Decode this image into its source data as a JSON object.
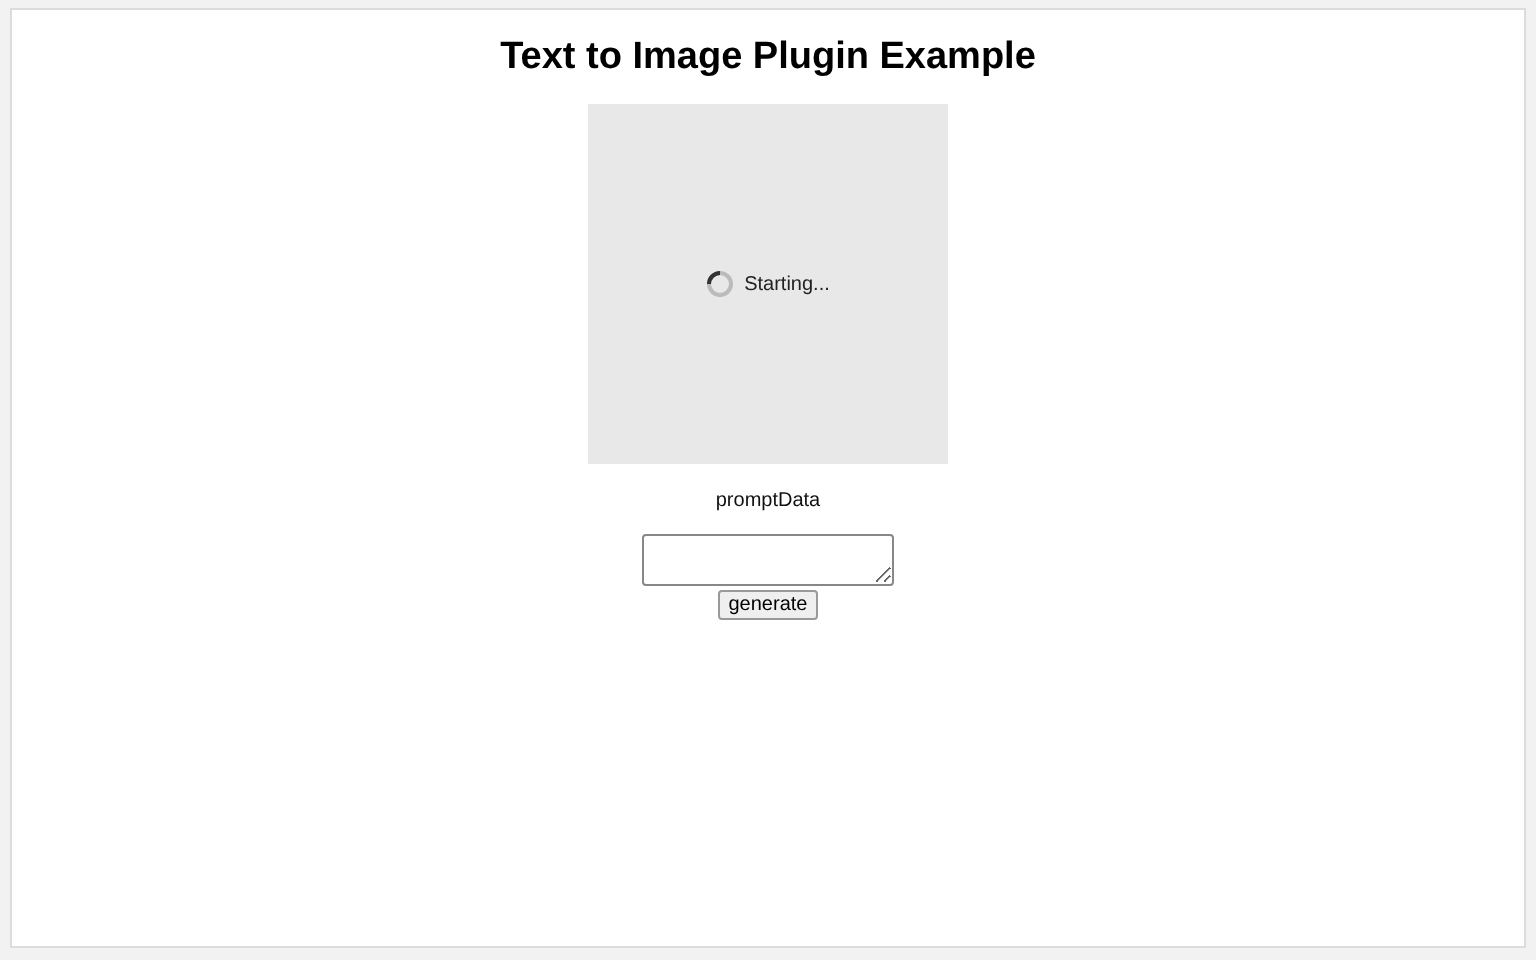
{
  "title": "Text to Image Plugin Example",
  "preview": {
    "status": "Starting..."
  },
  "prompt": {
    "label": "promptData"
  },
  "button": "generate"
}
